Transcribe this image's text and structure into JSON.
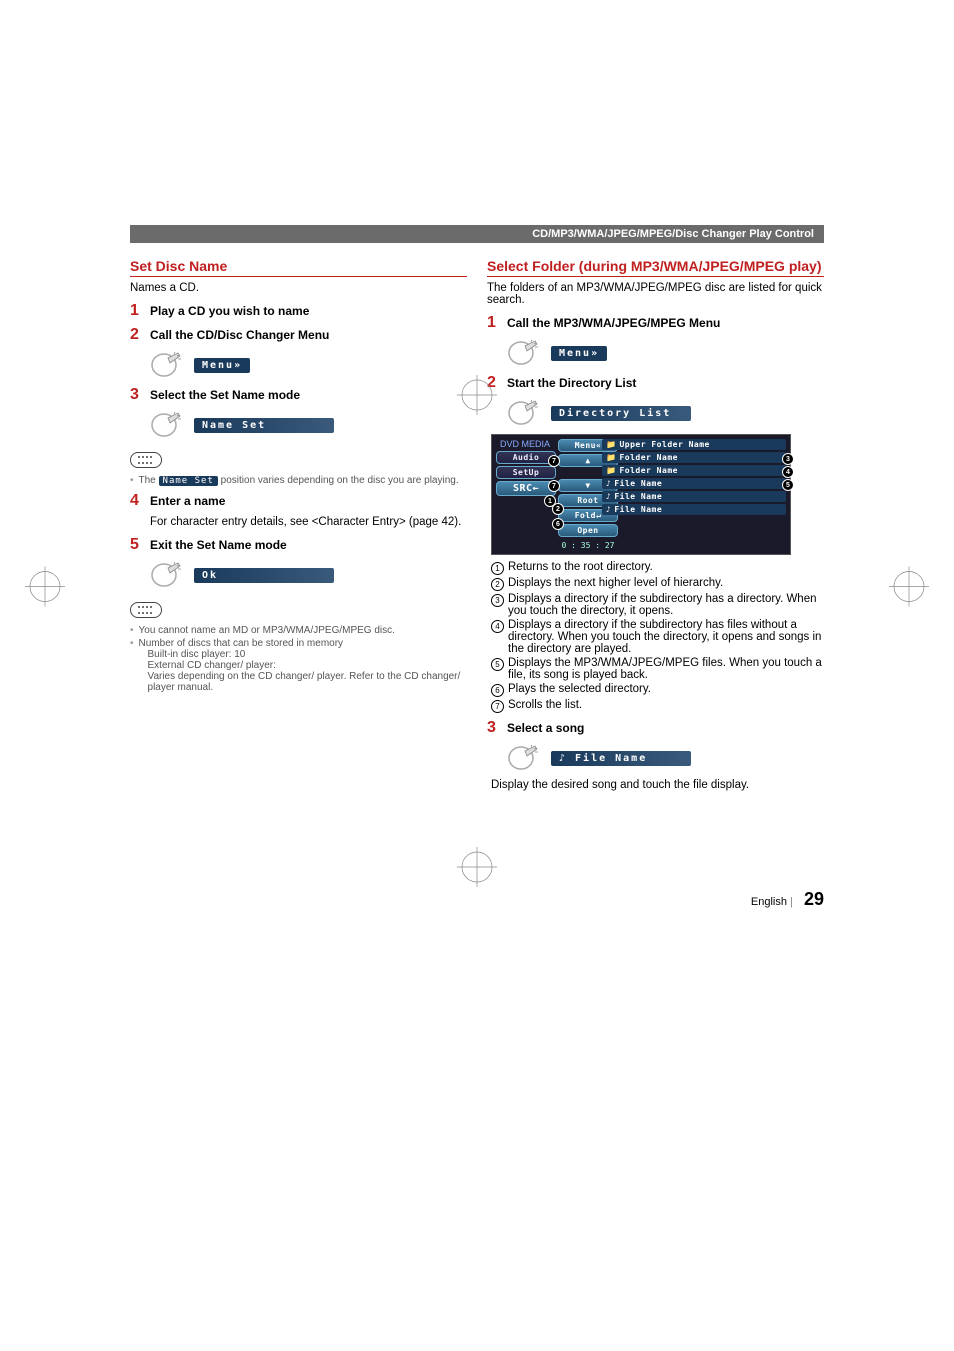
{
  "header_bar": "CD/MP3/WMA/JPEG/MPEG/Disc Changer Play Control",
  "left": {
    "title": "Set Disc Name",
    "intro": "Names a CD.",
    "step1": {
      "num": "1",
      "title": "Play a CD you wish to name"
    },
    "step2": {
      "num": "2",
      "title": "Call the CD/Disc Changer Menu",
      "button": "Menu»"
    },
    "step3": {
      "num": "3",
      "title": "Select the Set Name mode",
      "button": "Name Set"
    },
    "note3_pre": "The ",
    "note3_btn": "Name Set",
    "note3_post": " position varies depending on the disc you are playing.",
    "step4": {
      "num": "4",
      "title": "Enter a name",
      "body": "For character entry details, see <Character Entry> (page 42)."
    },
    "step5": {
      "num": "5",
      "title": "Exit the Set Name mode",
      "button": "Ok"
    },
    "note5_a": "You cannot name an MD or MP3/WMA/JPEG/MPEG disc.",
    "note5_b": "Number of discs that can be stored in memory",
    "note5_b1": "Built-in disc player: 10",
    "note5_b2": "External CD changer/ player:",
    "note5_b3": "Varies depending on the CD changer/ player. Refer to the CD changer/ player manual."
  },
  "right": {
    "title": "Select Folder (during MP3/WMA/JPEG/MPEG play)",
    "intro": "The folders of an MP3/WMA/JPEG/MPEG disc are listed for quick search.",
    "step1": {
      "num": "1",
      "title": "Call the MP3/WMA/JPEG/MPEG Menu",
      "button": "Menu»"
    },
    "step2": {
      "num": "2",
      "title": "Start the Directory List",
      "button": "Directory List"
    },
    "ss": {
      "header": "DVD MEDIA",
      "menu": "Menu«",
      "audio": "Audio",
      "setup": "SetUp",
      "src": "SRC←",
      "up": "▲",
      "down": "▼",
      "root": "Root",
      "fold": "Fold↵",
      "open": "Open",
      "time": "0 : 35 : 27",
      "upper": "Upper Folder Name",
      "f1": "Folder Name",
      "f2": "Folder Name",
      "file1": "File Name",
      "file2": "File Name",
      "file3": "File Name"
    },
    "enum": {
      "e1": "Returns to the root directory.",
      "e2": "Displays the next higher level of hierarchy.",
      "e3": "Displays a directory if the subdirectory has a directory. When you touch the directory, it opens.",
      "e4": "Displays a directory if the subdirectory has files without a directory. When you touch the directory, it opens and songs in the directory are played.",
      "e5": "Displays the MP3/WMA/JPEG/MPEG files. When you touch a file, its song is played back.",
      "e6": "Plays the selected directory.",
      "e7": "Scrolls the list."
    },
    "step3": {
      "num": "3",
      "title": "Select a song",
      "button": "♪ File Name",
      "body": "Display the desired song and touch the file display."
    }
  },
  "footer": {
    "lang": "English",
    "page": "29"
  }
}
